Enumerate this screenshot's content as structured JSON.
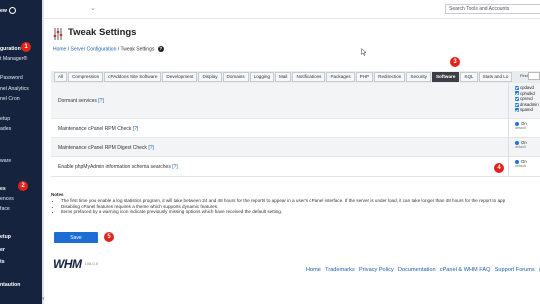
{
  "sidebar": {
    "items": [
      {
        "label": "ew",
        "bold": true,
        "icon": "circle-arrow-icon"
      },
      {
        "label": "guration",
        "bold": true
      },
      {
        "label": "t Manager®",
        "bold": false
      },
      {
        "label": "Password",
        "bold": false
      },
      {
        "label": "nel Analytics",
        "bold": false
      },
      {
        "label": "nel Cron",
        "bold": false
      },
      {
        "label": "etup",
        "bold": false
      },
      {
        "label": "ades",
        "bold": false
      },
      {
        "label": "ware",
        "bold": false
      },
      {
        "label": "es",
        "bold": true
      },
      {
        "label": "ences",
        "bold": false
      },
      {
        "label": "face",
        "bold": false
      },
      {
        "label": "etup",
        "bold": true
      },
      {
        "label": "er",
        "bold": true
      },
      {
        "label": "ts",
        "bold": true
      },
      {
        "label": "ntaution",
        "bold": true
      }
    ]
  },
  "header": {
    "search_placeholder": "Search Tools and Accounts",
    "page_title": "Tweak Settings",
    "breadcrumb": {
      "home": "Home",
      "sep1": " / ",
      "section": "Server Configuration",
      "sep2": " / ",
      "current": "Tweak Settings"
    }
  },
  "tabs": [
    "All",
    "Compression",
    "cPAddons Site Software",
    "Development",
    "Display",
    "Domains",
    "Logging",
    "Mail",
    "Notifications",
    "Packages",
    "PHP",
    "Redirection",
    "Security",
    "Software",
    "SQL",
    "Stats and Lo"
  ],
  "active_tab": "Software",
  "find_label": "Find",
  "settings": [
    {
      "label": "Dormant services",
      "ref": "[?]",
      "options": [
        "cpdavd",
        "cphulkd",
        "cpsrvd",
        "dnsadmin",
        "spamd"
      ]
    },
    {
      "label": "Maintenance cPanel RPM Check",
      "ref": "[?]",
      "value": "On",
      "default": "default"
    },
    {
      "label": "Maintenance cPanel RPM Digest Check",
      "ref": "[?]",
      "value": "On",
      "default": "default"
    },
    {
      "label": "Enable phpMyAdmin information schema searches",
      "ref": "[?]",
      "value": "On",
      "default": "default"
    }
  ],
  "notes": {
    "title": "Notes",
    "items": [
      "The first time you enable a log statistics program, it will take between 24 and 48 hours for the reports to appear in a user's cPanel interface. If the server is under load, it can take longer than 48 hours for the report to app",
      "Disabling cPanel features requires a theme which supports dynamic features.",
      "Items prefaced by a warning icon indicate previously missing options which have received the default setting."
    ]
  },
  "save_label": "Save",
  "callouts": [
    "1",
    "2",
    "3",
    "4",
    "5"
  ],
  "footer": {
    "logo": "WHM",
    "version": "108.0.8",
    "links": [
      "Home",
      "Trademarks",
      "Privacy Policy",
      "Documentation",
      "cPanel & WHM FAQ",
      "Support Forums",
      "cl"
    ]
  },
  "colors": {
    "sidebar_bg": "#15233f",
    "accent": "#1c6ed4",
    "callout": "#e2231a",
    "active_tab": "#3b3f45"
  }
}
